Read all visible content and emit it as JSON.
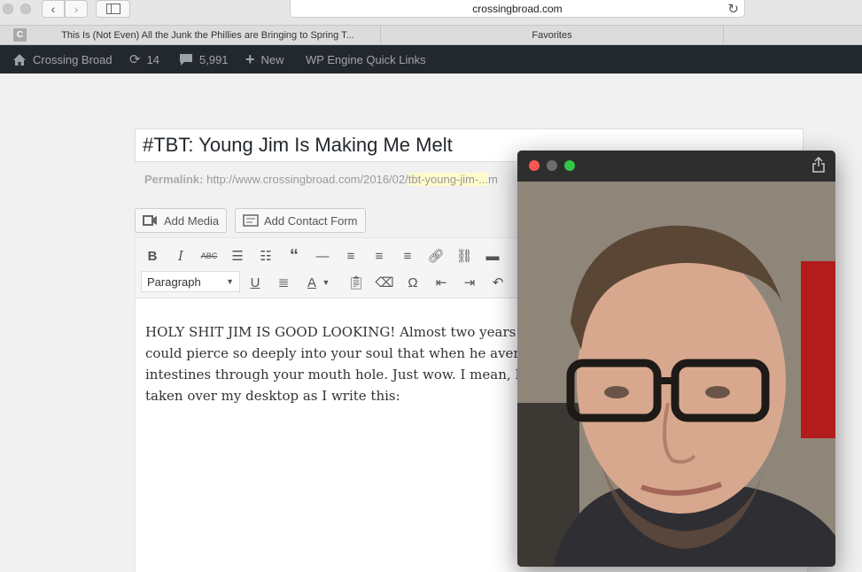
{
  "browser": {
    "url": "crossingbroad.com",
    "tabs": [
      {
        "favicon": "C",
        "title": "This Is (Not Even) All the Junk the Phillies are Bringing to Spring T..."
      },
      {
        "title": "Favorites"
      }
    ]
  },
  "adminbar": {
    "site_name": "Crossing Broad",
    "updates_count": "14",
    "comments_count": "5,991",
    "new_label": "New",
    "quick_links": "WP Engine Quick Links"
  },
  "post": {
    "title": "#TBT: Young Jim Is Making Me Melt",
    "permalink_label": "Permalink:",
    "permalink_base": "http://www.crossingbroad.com/2016/02/",
    "permalink_slug": "tbt-young-jim-...",
    "permalink_tail": "m",
    "add_media": "Add Media",
    "add_contact_form": "Add Contact Form",
    "format": "Paragraph",
    "body_lines": [
      "HOLY SHIT JIM IS GOOD LOOKING! Almost two years no",
      "could pierce so deeply into your soul that when he averts his",
      "intestines through your mouth hole. Just wow. I mean, I can",
      "taken over my desktop as I write this:"
    ]
  },
  "colors": {
    "adminbar_bg": "#23282d",
    "close": "#fc5753",
    "minimize": "#6e6e6e",
    "zoom": "#33c748"
  }
}
